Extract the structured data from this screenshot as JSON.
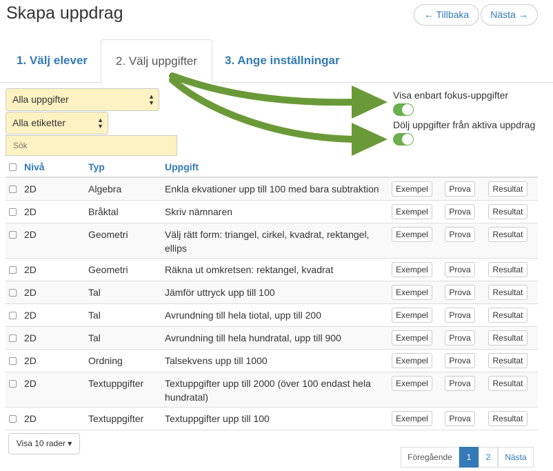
{
  "page": {
    "title": "Skapa uppdrag",
    "back_label": "← Tillbaka",
    "next_label": "Nästa →"
  },
  "tabs": [
    {
      "label": "1. Välj elever",
      "active": false
    },
    {
      "label": "2. Välj uppgifter",
      "active": true
    },
    {
      "label": "3. Ange inställningar",
      "active": false
    }
  ],
  "filters": {
    "task_select": "Alla uppgifter",
    "tag_select": "Alla etiketter",
    "search_placeholder": "Sök"
  },
  "toggles": [
    {
      "label": "Visa enbart fokus-uppgifter",
      "on": true
    },
    {
      "label": "Dölj uppgifter från aktiva uppdrag",
      "on": true
    }
  ],
  "table": {
    "headers": {
      "level": "Nivå",
      "type": "Typ",
      "task": "Uppgift"
    },
    "buttons": {
      "example": "Exempel",
      "try": "Prova",
      "result": "Resultat"
    },
    "rows": [
      {
        "level": "2D",
        "type": "Algebra",
        "task": "Enkla ekvationer upp till 100 med bara subtraktion"
      },
      {
        "level": "2D",
        "type": "Bråktal",
        "task": "Skriv nämnaren"
      },
      {
        "level": "2D",
        "type": "Geometri",
        "task": "Välj rätt form: triangel, cirkel, kvadrat, rektangel, ellips"
      },
      {
        "level": "2D",
        "type": "Geometri",
        "task": "Räkna ut omkretsen: rektangel, kvadrat"
      },
      {
        "level": "2D",
        "type": "Tal",
        "task": "Jämför uttryck upp till 100"
      },
      {
        "level": "2D",
        "type": "Tal",
        "task": "Avrundning till hela tiotal, upp till 200"
      },
      {
        "level": "2D",
        "type": "Tal",
        "task": "Avrundning till hela hundratal, upp till 900"
      },
      {
        "level": "2D",
        "type": "Ordning",
        "task": "Talsekvens upp till 1000"
      },
      {
        "level": "2D",
        "type": "Textuppgifter",
        "task": "Textuppgifter upp till 2000 (över 100 endast hela hundratal)"
      },
      {
        "level": "2D",
        "type": "Textuppgifter",
        "task": "Textuppgifter upp till 100"
      }
    ]
  },
  "footer": {
    "rows_select": "Visa 10 rader",
    "pager": {
      "prev": "Föregående",
      "pages": [
        "1",
        "2"
      ],
      "next": "Nästa"
    }
  },
  "colors": {
    "accent": "#337ab7",
    "toggle_on": "#6ab04c",
    "arrow": "#6a9a38",
    "select_bg": "#fdf2c2"
  }
}
